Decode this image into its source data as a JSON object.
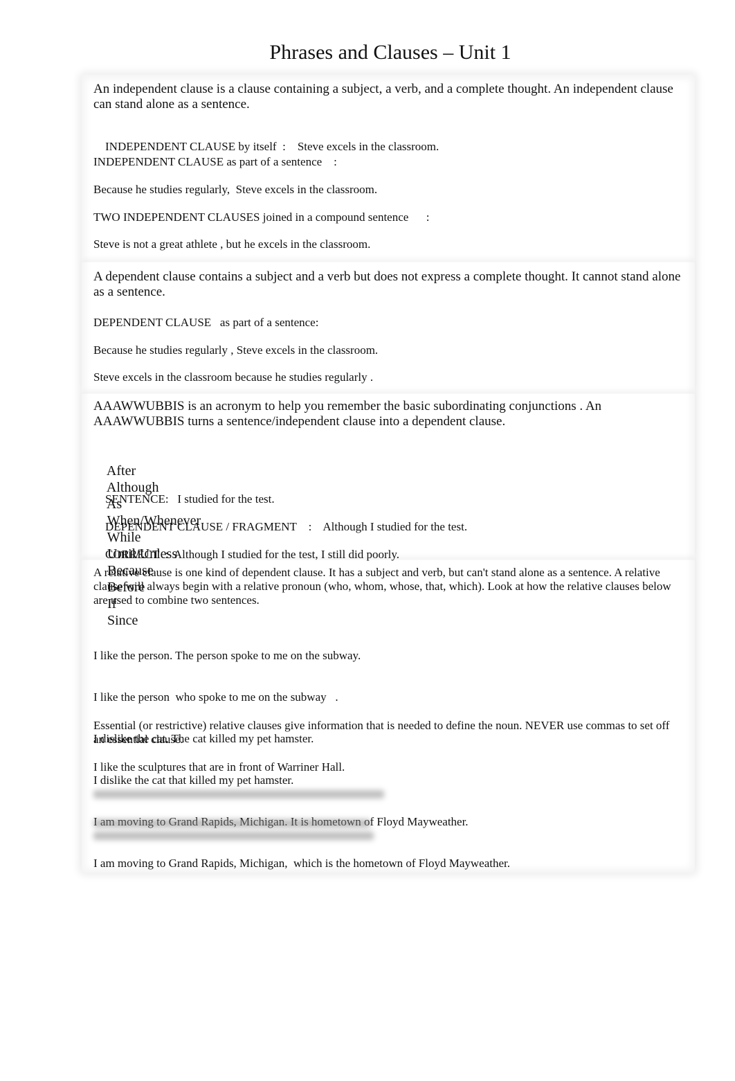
{
  "document": {
    "title": "Phrases and Clauses – Unit 1"
  },
  "independent": {
    "intro": "An independent clause   is a clause containing a subject, a verb, and a complete thought.  An independent clause can stand alone as a sentence.",
    "by_itself_label": "INDEPENDENT CLAUSE by itself  :",
    "by_itself_example": "Steve excels in the classroom.",
    "part_label": "INDEPENDENT CLAUSE as part of a sentence    :",
    "part_example": "Because he studies regularly,  Steve excels in the classroom.",
    "compound_label": "TWO INDEPENDENT CLAUSES joined in a compound sentence      :",
    "compound_example": "Steve is not a great athlete , but he excels in the classroom."
  },
  "dependent": {
    "intro": "A dependent clause   contains a subject and a verb but does not express a complete thought.  It cannot stand alone as a sentence.",
    "part_label": "DEPENDENT CLAUSE   as part of a sentence:",
    "example_1": "Because he studies regularly , Steve excels in the classroom.",
    "example_2": "Steve excels in the classroom because he studies regularly ."
  },
  "acronym": {
    "intro": "AAAWWUBBIS  is an acronym to help you remember the basic subordinating conjunctions   .  An AAAWWUBBIS turns a sentence/independent clause into a dependent clause.",
    "conjunctions": [
      "After",
      "Although",
      "As",
      "When/Whenever",
      "While",
      "Until/Unless",
      "Because",
      "Before",
      "If",
      "Since"
    ],
    "sentence_label": "SENTENCE:",
    "sentence_example": "I studied for the test.",
    "fragment_label": "DEPENDENT CLAUSE / FRAGMENT    :",
    "fragment_example": "Although I studied for the test.",
    "correct_label": "CORRECT  :",
    "correct_example": "Although I studied for the test, I still did poorly."
  },
  "relative": {
    "intro": "A relative clause   is one kind of dependent clause. It has a subject and verb, but can't stand alone as a sentence.   A relative clause will always begin with a relative pronoun (who, whom, whose, that, which).  Look at how the relative clauses below are used to combine two sentences.",
    "examples": [
      "I like the person. The person spoke to me on the subway.",
      "I like the person  who spoke to me on the subway   .",
      "I dislike the cat. The cat killed my pet hamster.",
      "I dislike the cat that killed my pet hamster.",
      "I am moving to Grand Rapids, Michigan. It is hometown of Floyd Mayweather.",
      "I am moving to Grand Rapids, Michigan,  which is the hometown of Floyd Mayweather."
    ],
    "essential_intro": "Essential (or restrictive) relative clauses      give information that is needed to define the noun.  NEVER use commas to set off an essential clause.",
    "essential_example": "I like the sculptures that are in front of Warriner Hall."
  }
}
